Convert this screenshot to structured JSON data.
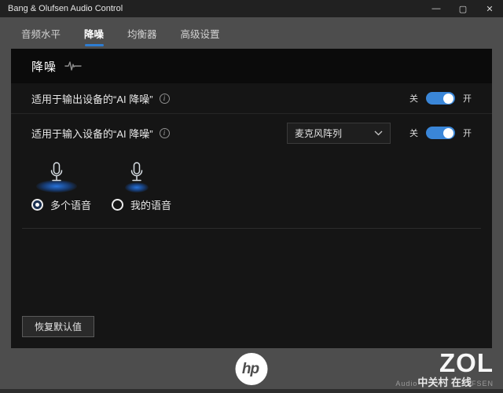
{
  "window": {
    "title": "Bang & Olufsen Audio Control",
    "minimize_glyph": "—",
    "maximize_glyph": "▢",
    "close_glyph": "✕"
  },
  "tabs": [
    {
      "label": "音频水平"
    },
    {
      "label": "降噪"
    },
    {
      "label": "均衡器"
    },
    {
      "label": "高级设置"
    }
  ],
  "panel": {
    "title": "降噪",
    "rows": [
      {
        "label": "适用于输出设备的“AI 降噪”",
        "off_label": "关",
        "on_label": "开",
        "state": "on"
      },
      {
        "label": "适用于输入设备的“AI 降噪”",
        "device_selector": "麦克风阵列",
        "off_label": "关",
        "on_label": "开",
        "state": "on"
      }
    ],
    "voice_options": [
      {
        "label": "多个语音",
        "selected": true
      },
      {
        "label": "我的语音",
        "selected": false
      }
    ],
    "restore_button": "恢复默认值"
  },
  "footer": {
    "hp_logo": "hp",
    "watermark_title": "ZOL",
    "watermark_prefix": "Audio",
    "watermark_mid": "中关村 在线",
    "watermark_suffix": "FSEN"
  },
  "colors": {
    "accent_blue": "#2e7dd2",
    "toggle_blue": "#3a86d8",
    "panel_bg": "#151515",
    "header_bg": "#0b0b0b",
    "chrome_bg": "#4d4d4d",
    "titlebar_bg": "#212121"
  }
}
